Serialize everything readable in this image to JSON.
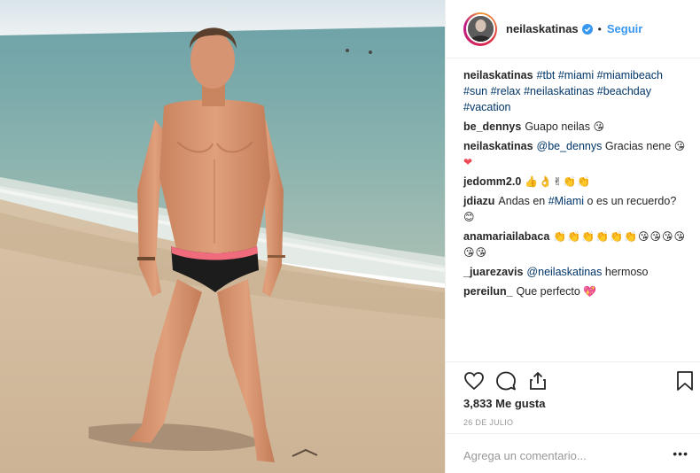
{
  "post": {
    "username": "neilaskatinas",
    "separator": "•",
    "follow_label": "Seguir",
    "likes_text": "3,833 Me gusta",
    "date": "26 DE JULIO",
    "add_comment_placeholder": "Agrega un comentario...",
    "more_options": "•••",
    "photo_icon": "beach-photo"
  },
  "comments": [
    {
      "user": "neilaskatinas",
      "segments": [
        {
          "text": "#tbt #miami #miamibeach #sun #relax #neilaskatinas #beachday #vacation",
          "kind": "tag"
        }
      ]
    },
    {
      "user": "be_dennys",
      "segments": [
        {
          "text": "Guapo neilas",
          "kind": "text"
        },
        {
          "text": "😘",
          "kind": "emoji"
        }
      ]
    },
    {
      "user": "neilaskatinas",
      "segments": [
        {
          "text": "@be_dennys",
          "kind": "tag"
        },
        {
          "text": "Gracias nene",
          "kind": "text"
        },
        {
          "text": "😘",
          "kind": "emoji"
        },
        {
          "text": "❤",
          "kind": "heart"
        }
      ]
    },
    {
      "user": "jedomm2.0",
      "segments": [
        {
          "text": "👍👌✌👏👏",
          "kind": "emoji"
        }
      ]
    },
    {
      "user": "jdiazu",
      "segments": [
        {
          "text": "Andas en",
          "kind": "text"
        },
        {
          "text": "#Miami",
          "kind": "tag"
        },
        {
          "text": "o es un recuerdo?",
          "kind": "text"
        },
        {
          "text": "😊",
          "kind": "emoji"
        }
      ]
    },
    {
      "user": "anamariailabaca",
      "segments": [
        {
          "text": "👏👏👏👏👏👏😘😘😘😘😘😘",
          "kind": "emoji"
        }
      ]
    },
    {
      "user": "_juarezavis",
      "segments": [
        {
          "text": "@neilaskatinas",
          "kind": "tag"
        },
        {
          "text": "hermoso",
          "kind": "text"
        }
      ]
    },
    {
      "user": "pereilun_",
      "segments": [
        {
          "text": "Que perfecto",
          "kind": "text"
        },
        {
          "text": "💖",
          "kind": "heart"
        }
      ]
    }
  ],
  "icons": {
    "like": "heart-icon",
    "comment": "comment-icon",
    "share": "share-icon",
    "save": "bookmark-icon",
    "verified": "verified-badge-icon"
  },
  "colors": {
    "link": "#3897f0",
    "tag": "#003569",
    "text": "#262626",
    "muted": "#999999",
    "border": "#efefef"
  }
}
